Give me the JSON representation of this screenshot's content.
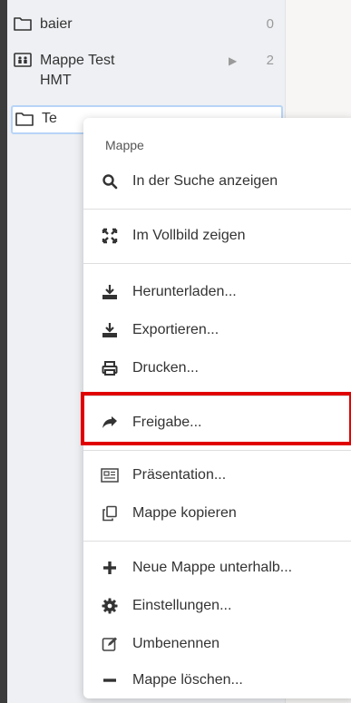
{
  "sidebar": {
    "folders": [
      {
        "label": "baier",
        "count": "0",
        "icon": "folder-icon"
      },
      {
        "label": "Mappe Test HMT",
        "line1": "Mappe Test",
        "line2": "HMT",
        "count": "2",
        "icon": "shared-folder-icon",
        "expandable": true
      },
      {
        "label": "Te",
        "icon": "folder-icon",
        "selected": true
      }
    ]
  },
  "context_menu": {
    "header": "Mappe",
    "items": [
      {
        "label": "In der Suche anzeigen",
        "icon": "search-icon"
      },
      {
        "label": "Im Vollbild zeigen",
        "icon": "fullscreen-icon"
      },
      {
        "label": "Herunterladen...",
        "icon": "download-icon"
      },
      {
        "label": "Exportieren...",
        "icon": "export-icon"
      },
      {
        "label": "Drucken...",
        "icon": "print-icon"
      },
      {
        "label": "Freigabe...",
        "icon": "share-icon",
        "highlighted": true
      },
      {
        "label": "Präsentation...",
        "icon": "presentation-icon"
      },
      {
        "label": "Mappe kopieren",
        "icon": "copy-icon"
      },
      {
        "label": "Neue Mappe unterhalb...",
        "icon": "plus-icon"
      },
      {
        "label": "Einstellungen...",
        "icon": "gear-icon"
      },
      {
        "label": "Umbenennen",
        "icon": "edit-icon"
      },
      {
        "label": "Mappe löschen...",
        "icon": "minus-icon"
      }
    ]
  },
  "colors": {
    "highlight_border": "#e00000",
    "selection_border": "#b8d4f7"
  }
}
